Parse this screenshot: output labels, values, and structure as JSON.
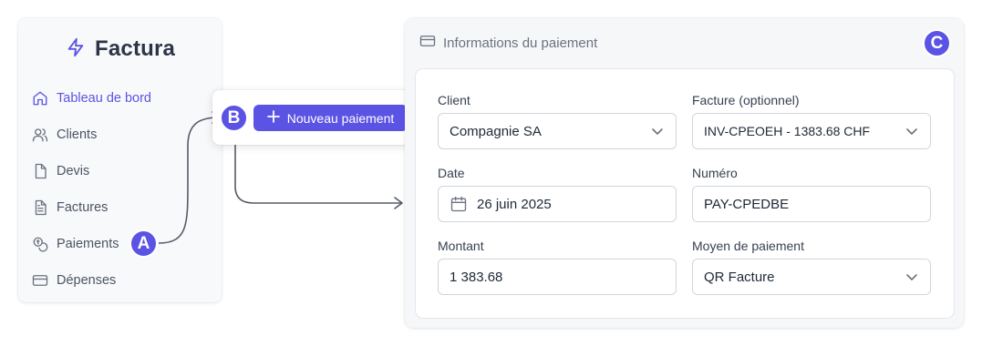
{
  "colors": {
    "accent": "#5b53e3",
    "text": "#1f2937",
    "muted": "#6b7280"
  },
  "sidebar": {
    "brand": {
      "icon": "bolt-icon",
      "name": "Factura"
    },
    "items": [
      {
        "label": "Tableau de bord",
        "icon": "home-icon",
        "active": true
      },
      {
        "label": "Clients",
        "icon": "users-icon"
      },
      {
        "label": "Devis",
        "icon": "file-icon"
      },
      {
        "label": "Factures",
        "icon": "file-text-icon"
      },
      {
        "label": "Paiements",
        "icon": "coins-icon"
      },
      {
        "label": "Dépenses",
        "icon": "credit-card-icon"
      }
    ]
  },
  "popover": {
    "button_label": "Nouveau paiement",
    "button_icon": "plus-icon"
  },
  "badges": {
    "a": "A",
    "b": "B",
    "c": "C"
  },
  "panel": {
    "title": "Informations du paiement",
    "title_icon": "credit-card-icon",
    "fields": {
      "client": {
        "label": "Client",
        "value": "Compagnie SA",
        "type": "select"
      },
      "invoice": {
        "label": "Facture (optionnel)",
        "value": "INV-CPEOEH - 1383.68 CHF",
        "type": "select"
      },
      "date": {
        "label": "Date",
        "value": "26 juin 2025",
        "type": "date"
      },
      "number": {
        "label": "Numéro",
        "value": "PAY-CPEDBE",
        "type": "text"
      },
      "amount": {
        "label": "Montant",
        "value": "1 383.68",
        "type": "text"
      },
      "method": {
        "label": "Moyen de paiement",
        "value": "QR Facture",
        "type": "select"
      }
    }
  }
}
